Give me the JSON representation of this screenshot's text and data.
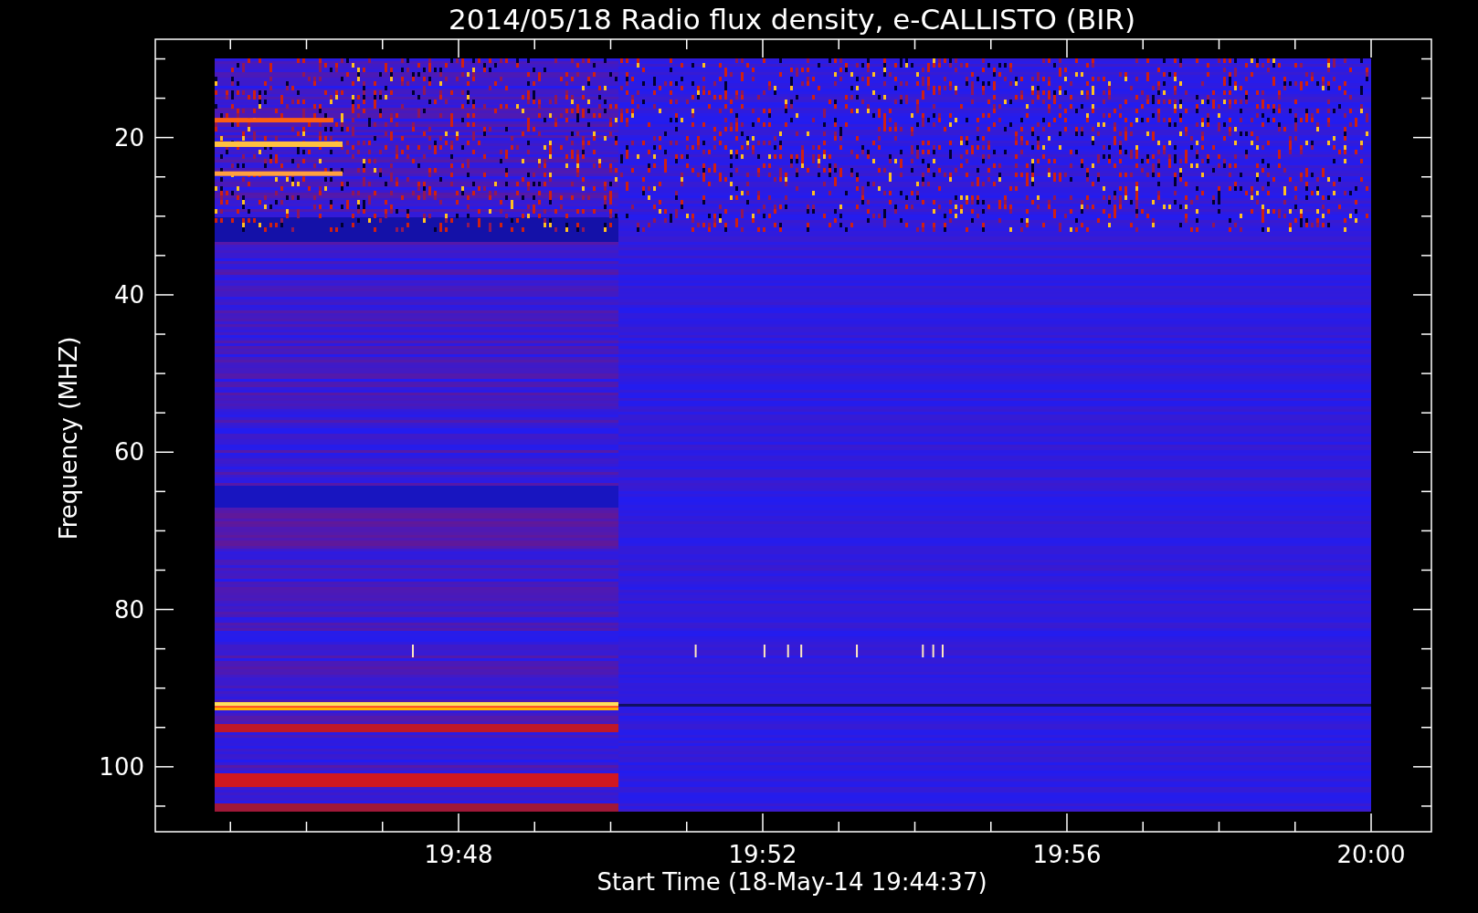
{
  "title": "2014/05/18  Radio flux density, e-CALLISTO (BIR)",
  "y_axis": {
    "label": "Frequency (MHZ)",
    "ticks": [
      "20",
      "40",
      "60",
      "80",
      "100"
    ]
  },
  "x_axis": {
    "label": "Start Time (18-May-14 19:44:37)",
    "ticks": [
      "19:48",
      "19:52",
      "19:56",
      "20:00"
    ]
  }
}
